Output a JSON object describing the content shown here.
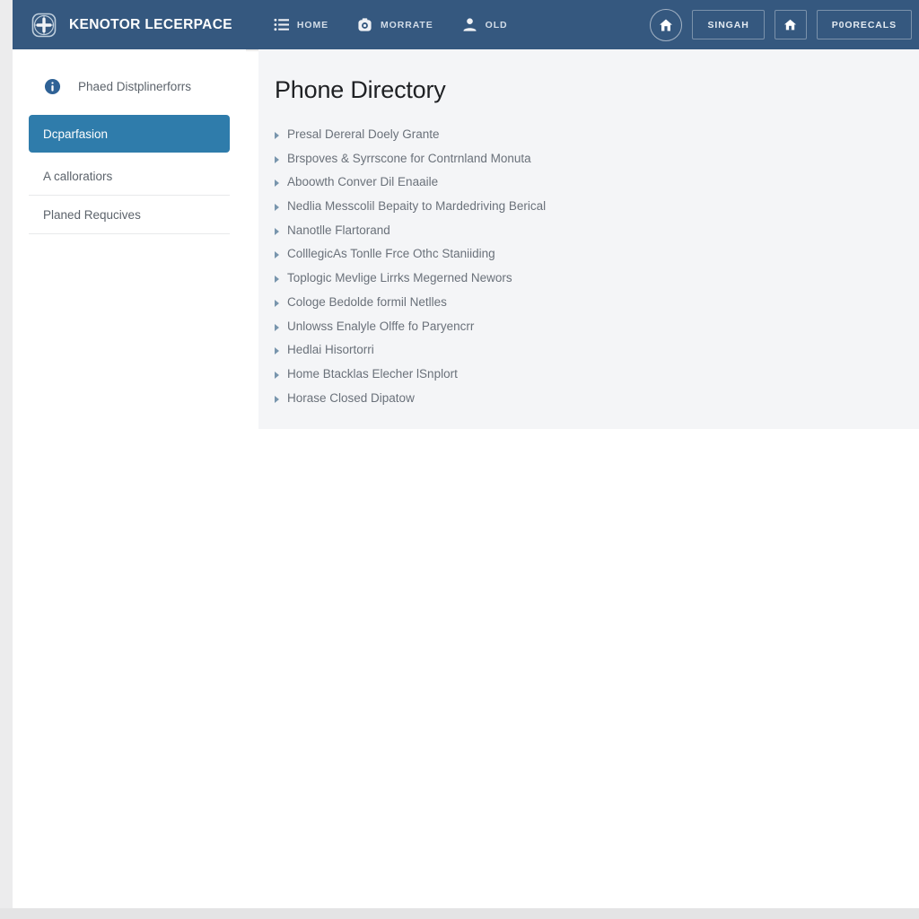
{
  "header": {
    "brand": {
      "logo_icon": "shield-plus-logo-icon",
      "name": "KENOTOR LECERPACE"
    },
    "nav": [
      {
        "icon": "list-menu-icon",
        "label": "HOME"
      },
      {
        "icon": "camera-circle-icon",
        "label": "MORRATE"
      },
      {
        "icon": "user-person-icon",
        "label": "OLD"
      }
    ],
    "actions": {
      "home_circle": {
        "icon": "home-icon",
        "label": ""
      },
      "singah": {
        "label": "SINGAH"
      },
      "home_square": {
        "icon": "home-icon",
        "label": ""
      },
      "poorecals": {
        "label": "P0ORECALS"
      }
    }
  },
  "sidebar": {
    "heading": {
      "icon": "info-circle-icon",
      "label": "Phaed Distplinerforrs"
    },
    "items": [
      {
        "label": "Dcparfasion",
        "active": true
      },
      {
        "label": "A calloratiors",
        "active": false
      },
      {
        "label": "Planed Requcives",
        "active": false
      }
    ]
  },
  "main": {
    "title": "Phone Directory",
    "entries": [
      "Presal Dereral Doely Grante",
      "Brspoves & Syrrscone for Contrnland Monuta",
      "Aboowth Conver Dil Enaaile",
      "Nedlia Messcolil Bepaity to Mardedriving Berical",
      "Nanotlle Flartorand",
      "ColllegicAs Tonlle Frce Othc Staniiding",
      "Toplogic Mevlige Lirrks Megerned Newors",
      "Cologe Bedolde formil Netlles",
      "Unlowss Enalyle Olffe fo Paryencrr",
      "Hedlai Hisortorri",
      "Home Btacklas Elecher lSnplort",
      "Horase Closed Dipatow"
    ]
  },
  "colors": {
    "header_bg": "#35587f",
    "accent_active": "#2f7cab",
    "panel_bg": "#f4f5f7",
    "text_muted": "#6a717a"
  }
}
